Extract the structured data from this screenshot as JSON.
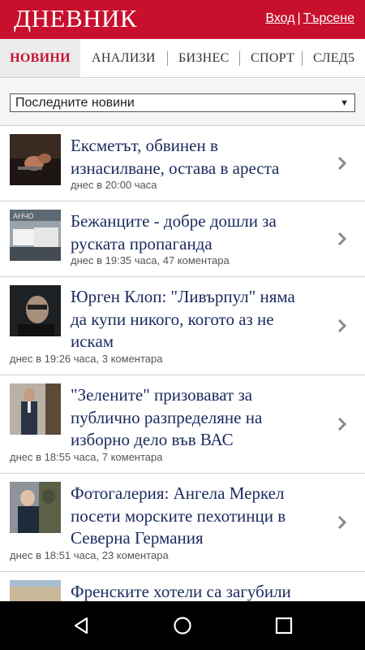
{
  "header": {
    "logo": "ДНЕВНИК",
    "login": "Вход",
    "separator": "|",
    "search": "Търсене",
    "brand_color": "#c8102e"
  },
  "tabs": [
    {
      "label": "НОВИНИ",
      "active": true
    },
    {
      "label": "АНАЛИЗИ",
      "active": false
    },
    {
      "label": "БИЗНЕС",
      "active": false
    },
    {
      "label": "СПОРТ",
      "active": false
    },
    {
      "label": "СЛЕД5",
      "active": false
    }
  ],
  "filter": {
    "selected": "Последните новини",
    "arrow_icon": "triangle-down-icon"
  },
  "articles": [
    {
      "title_lines": [
        "Ексметът, обвинен в",
        "изнасилване, остава в ареста"
      ],
      "meta": "днес в 20:00 часа"
    },
    {
      "title_lines": [
        "Бежанците - добре дошли за",
        "руската пропаганда"
      ],
      "meta": "днес в 19:35 часа, 47 коментара"
    },
    {
      "title_lines": [
        "Юрген Клоп: \"Ливърпул\" няма",
        "да купи никого, когото аз не",
        "искам"
      ],
      "meta": "днес в 19:26 часа, 3 коментара"
    },
    {
      "title_lines": [
        "\"Зелените\" призовават за",
        "публично разпределяне на",
        "изборно дело във ВАС"
      ],
      "meta": "днес в 18:55 часа, 7 коментара"
    },
    {
      "title_lines": [
        "Фотогалерия: Ангела Меркел",
        "посети морските пехотинци в",
        "Северна Германия"
      ],
      "meta": "днес в 18:51 часа, 23 коментара"
    },
    {
      "title_lines": [
        "Френските хотели са загубили"
      ],
      "meta": ""
    }
  ],
  "navbar": {
    "back_icon": "back-triangle-icon",
    "home_icon": "home-circle-icon",
    "recents_icon": "recents-square-icon"
  }
}
